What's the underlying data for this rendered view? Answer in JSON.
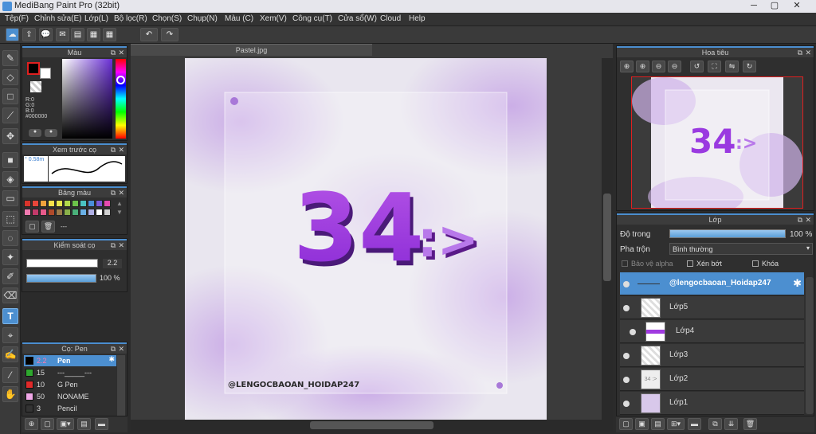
{
  "window": {
    "title": "MediBang Paint Pro (32bit)",
    "min": "─",
    "max": "▢",
    "close": "✕"
  },
  "menu": [
    "Tệp(F)",
    "Chỉnh sửa(E)",
    "Lớp(L)",
    "Bộ lọc(R)",
    "Chọn(S)",
    "Chụp(N)",
    "Màu (C)",
    "Xem(V)",
    "Công cụ(T)",
    "Cửa sổ(W)",
    "Cloud",
    "Help"
  ],
  "toolbar_icons": [
    "cloud-icon",
    "upload-icon",
    "chat-icon",
    "comment-icon",
    "document-icon",
    "layer-grid-icon",
    "grid-icon",
    "undo-icon",
    "redo-icon"
  ],
  "toolbar_glyphs": [
    "☁",
    "⇪",
    "💬",
    "✉",
    "▤",
    "▦",
    "▦",
    "↶",
    "↷"
  ],
  "tools": [
    {
      "name": "brush-tool",
      "glyph": "✎"
    },
    {
      "name": "eraser-tool",
      "glyph": "◇"
    },
    {
      "name": "rectangle-tool",
      "glyph": "□"
    },
    {
      "name": "pen-line-tool",
      "glyph": "⟋"
    },
    {
      "name": "move-tool",
      "glyph": "✥"
    },
    {
      "name": "shape-fill-tool",
      "glyph": "■"
    },
    {
      "name": "bucket-tool",
      "glyph": "◈"
    },
    {
      "name": "gradient-tool",
      "glyph": "▭"
    },
    {
      "name": "select-rect-tool",
      "glyph": "⬚"
    },
    {
      "name": "lasso-tool",
      "glyph": "◌"
    },
    {
      "name": "magic-wand-tool",
      "glyph": "✦"
    },
    {
      "name": "select-pen-tool",
      "glyph": "✐"
    },
    {
      "name": "select-eraser-tool",
      "glyph": "⌫"
    },
    {
      "name": "text-tool",
      "glyph": "T"
    },
    {
      "name": "operation-tool",
      "glyph": "⌖"
    },
    {
      "name": "blur-tool",
      "glyph": "✍"
    },
    {
      "name": "eyedropper-tool",
      "glyph": "⁄"
    },
    {
      "name": "hand-tool",
      "glyph": "✋"
    }
  ],
  "color_panel": {
    "title": "Màu",
    "r": "R:0",
    "g": "G:0",
    "b": "B:0",
    "hex": "#000000",
    "fg": "#000000",
    "bg": "#ffffff",
    "hue": "#6a2fd6"
  },
  "brush_preview": {
    "title": "Xem trước cọ",
    "size": "° 0.58m"
  },
  "palette": {
    "title": "Bảng màu",
    "more": "---",
    "colors": [
      "#d9342b",
      "#e8463a",
      "#f0a23c",
      "#f7e04a",
      "#e6e64c",
      "#b0d94a",
      "#6cc24a",
      "#4ac2c2",
      "#4a8ed9",
      "#7a5ad9",
      "#e64ab0",
      "#f07ab0",
      "#c23a6a",
      "#e85a8a",
      "#b04a2a",
      "#9a7a4a",
      "#8ab04a",
      "#4ab07a",
      "#6ab0e6",
      "#b0b0e6",
      "#ffffff",
      "#d0d0d0"
    ]
  },
  "brush_control": {
    "title": "Kiểm soát cọ",
    "size": "2.2",
    "opacity": "100 %",
    "opacity_fill": 1.0
  },
  "brush_list": {
    "title": "Cọ: Pen",
    "items": [
      {
        "size": "2.2",
        "name": "Pen",
        "color": "#000000",
        "selected": true
      },
      {
        "size": "15",
        "name": "---_____---",
        "color": "#2ea82e",
        "selected": false
      },
      {
        "size": "10",
        "name": "G Pen",
        "color": "#e02a2a",
        "selected": false
      },
      {
        "size": "50",
        "name": "NONAME",
        "color": "#f0a8e8",
        "selected": false
      },
      {
        "size": "3",
        "name": "Pencil",
        "color": "#333333",
        "selected": false
      }
    ]
  },
  "document": {
    "tab": "Pastel.jpg"
  },
  "artwork": {
    "number": "34",
    "arrow": ":>",
    "credit": "@LENGOCBAOAN_HOIDAP247"
  },
  "navigator": {
    "title": "Hoa tiêu",
    "icons": [
      "zoom-in-icon",
      "zoom-in-icon",
      "zoom-out-icon",
      "zoom-out-icon",
      "rotate-left-icon",
      "fit-icon",
      "flip-icon",
      "rotate-reset-icon"
    ],
    "glyphs": [
      "⊕",
      "⊕",
      "⊖",
      "⊖",
      "↺",
      "⛶",
      "⇋",
      "↻"
    ]
  },
  "layers": {
    "title": "Lớp",
    "opacity_label": "Độ trong",
    "opacity_value": "100 %",
    "opacity_fill": 1.0,
    "blend_label": "Pha trộn",
    "blend_value": "Bình thường",
    "protect_alpha": "Bảo vệ alpha",
    "clipping": "Xén bớt",
    "lock": "Khóa",
    "rows": [
      {
        "name": "@lengocbaoan_Hoidap247",
        "selected": true
      },
      {
        "name": "Lớp5",
        "selected": false
      },
      {
        "name": "Lớp4",
        "selected": false
      },
      {
        "name": "Lớp3",
        "selected": false
      },
      {
        "name": "Lớp2",
        "selected": false
      },
      {
        "name": "Lớp1",
        "selected": false
      }
    ]
  }
}
